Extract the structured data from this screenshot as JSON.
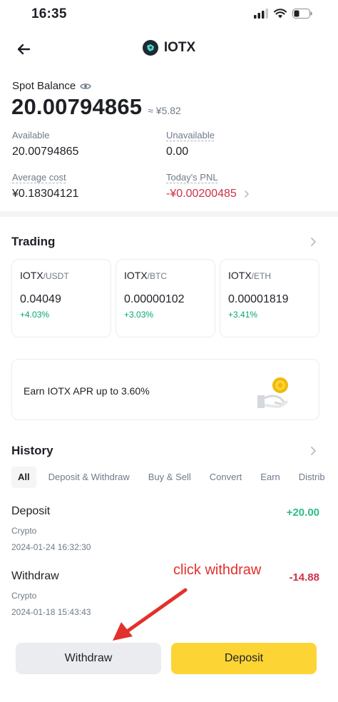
{
  "status_bar": {
    "time": "16:35"
  },
  "header": {
    "coin_name": "IOTX"
  },
  "balance": {
    "label": "Spot Balance",
    "value": "20.00794865",
    "fiat": "≈ ¥5.82"
  },
  "stats": {
    "available_label": "Available",
    "available_value": "20.00794865",
    "unavailable_label": "Unavailable",
    "unavailable_value": "0.00",
    "avg_cost_label": "Average cost",
    "avg_cost_value": "¥0.18304121",
    "pnl_label": "Today's PNL",
    "pnl_value": "-¥0.00200485"
  },
  "trading": {
    "title": "Trading",
    "pairs": [
      {
        "base": "IOTX",
        "quote": "/USDT",
        "price": "0.04049",
        "change": "+4.03%"
      },
      {
        "base": "IOTX",
        "quote": "/BTC",
        "price": "0.00000102",
        "change": "+3.03%"
      },
      {
        "base": "IOTX",
        "quote": "/ETH",
        "price": "0.00001819",
        "change": "+3.41%"
      }
    ]
  },
  "earn": {
    "text": "Earn IOTX APR up to 3.60%"
  },
  "history": {
    "title": "History",
    "tabs": [
      "All",
      "Deposit & Withdraw",
      "Buy & Sell",
      "Convert",
      "Earn",
      "Distrib"
    ],
    "items": [
      {
        "type": "Deposit",
        "sub": "Crypto",
        "date": "2024-01-24 16:32:30",
        "amount": "+20.00"
      },
      {
        "type": "Withdraw",
        "sub": "Crypto",
        "date": "2024-01-18 15:43:43",
        "amount": "-14.88"
      }
    ]
  },
  "annotation": {
    "text": "click withdraw"
  },
  "actions": {
    "withdraw_label": "Withdraw",
    "deposit_label": "Deposit"
  },
  "colors": {
    "positive": "#2ebd85",
    "negative": "#cf304a",
    "brand_yellow": "#fcd535",
    "annotation_red": "#e2312b"
  }
}
